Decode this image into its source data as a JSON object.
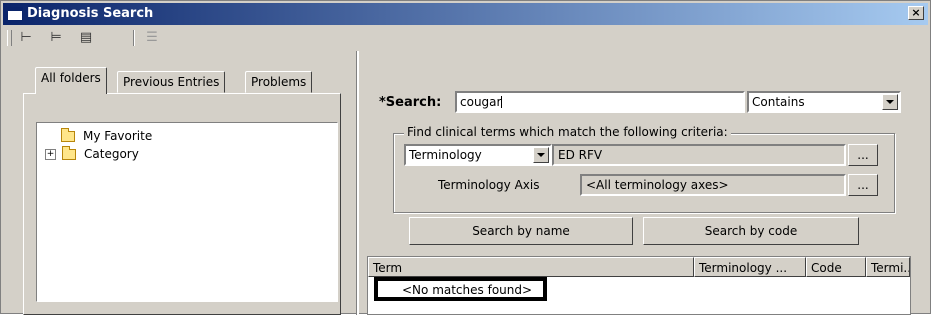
{
  "window": {
    "title": "Diagnosis Search",
    "close_glyph": "×"
  },
  "toolbar": {
    "icons": [
      "hierarchy-icon",
      "hierarchy-alt-icon",
      "add-folder-icon",
      "properties-icon"
    ]
  },
  "tabs": [
    {
      "label": "All folders",
      "active": true
    },
    {
      "label": "Previous Entries",
      "active": false
    },
    {
      "label": "Problems",
      "active": false
    }
  ],
  "tree": [
    {
      "label": "My Favorite",
      "expandable": false
    },
    {
      "label": "Category",
      "expandable": true
    }
  ],
  "search": {
    "label": "*Search:",
    "value": "cougar",
    "match_mode": "Contains",
    "criteria_caption": "Find clinical terms which match the following criteria:",
    "terminology_select": "Terminology",
    "terminology_value": "ED RFV",
    "axis_label": "Terminology Axis",
    "axis_value": "<All terminology axes>",
    "browse_label": "...",
    "search_by_name": "Search by name",
    "search_by_code": "Search by code"
  },
  "results": {
    "columns": [
      "Term",
      "Terminology ...",
      "Code",
      "Termi..."
    ],
    "empty_message": "<No matches found>"
  }
}
